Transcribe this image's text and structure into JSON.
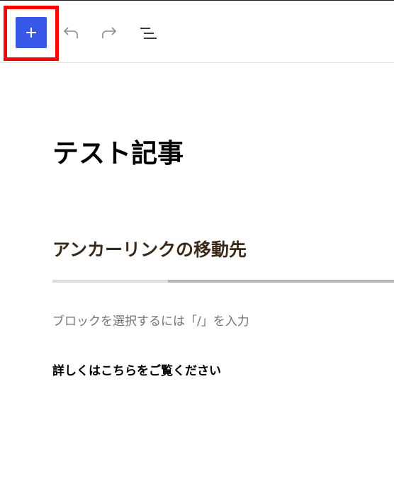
{
  "toolbar": {
    "add_block_icon": "plus-icon",
    "undo_icon": "undo-icon",
    "redo_icon": "redo-icon",
    "list_view_icon": "list-view-icon",
    "highlight_color": "#ff0000",
    "accent_color": "#3858e9"
  },
  "editor": {
    "post_title": "テスト記事",
    "heading": "アンカーリンクの移動先",
    "placeholder": "ブロックを選択するには「/」を入力",
    "paragraph": "詳しくはこちらをご覧ください"
  }
}
